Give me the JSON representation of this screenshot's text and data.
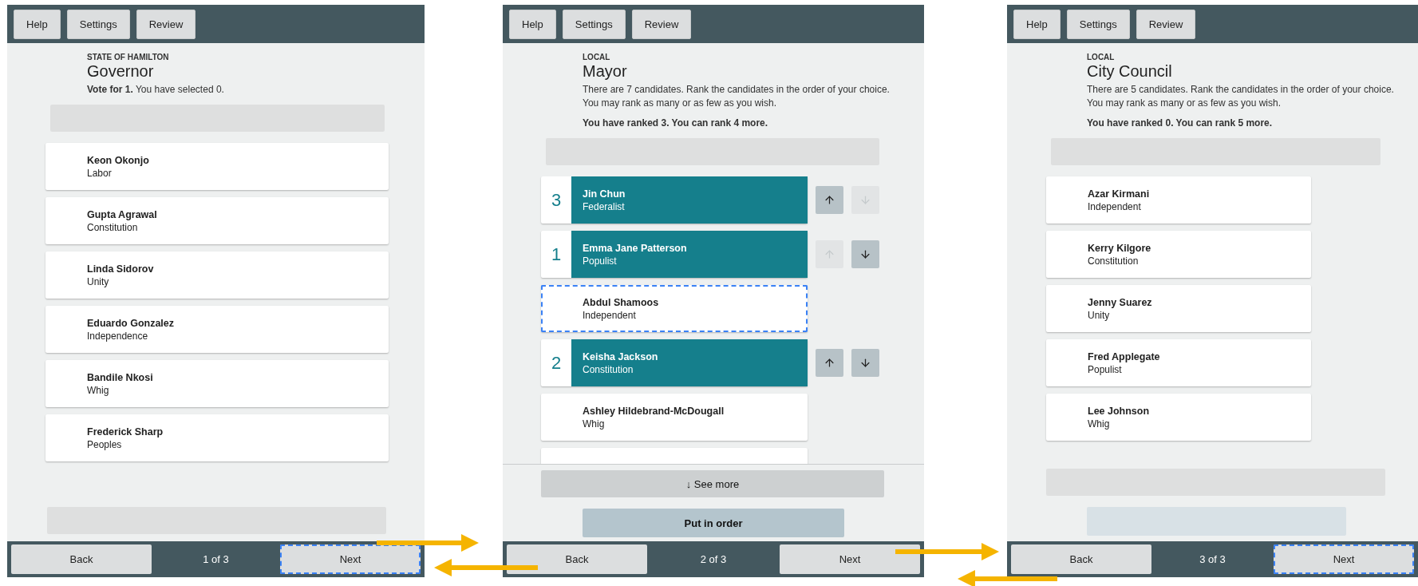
{
  "screens": [
    {
      "toolbar": [
        "Help",
        "Settings",
        "Review"
      ],
      "district": "STATE OF HAMILTON",
      "title": "Governor",
      "instructions": [
        "**Vote for 1.** You have selected 0."
      ],
      "top_button": {
        "disabled": true
      },
      "candidates": [
        {
          "name": "Keon Okonjo",
          "party": "Labor",
          "selected": false,
          "focused": false
        },
        {
          "name": "Gupta Agrawal",
          "party": "Constitution",
          "selected": false,
          "focused": false
        },
        {
          "name": "Linda Sidorov",
          "party": "Unity",
          "selected": false,
          "focused": false
        },
        {
          "name": "Eduardo Gonzalez",
          "party": "Independence",
          "selected": false,
          "focused": false
        },
        {
          "name": "Bandile Nkosi",
          "party": "Whig",
          "selected": false,
          "focused": false
        },
        {
          "name": "Frederick Sharp",
          "party": "Peoples",
          "selected": false,
          "focused": false
        }
      ],
      "bottom_buttons": [
        {
          "kind": "wide",
          "disabled": true
        }
      ],
      "nav": {
        "back": "Back",
        "page": "1 of 3",
        "next": "Next",
        "next_focused": true
      }
    },
    {
      "toolbar": [
        "Help",
        "Settings",
        "Review"
      ],
      "district": "LOCAL",
      "title": "Mayor",
      "instructions": [
        "There are 7 candidates. Rank the candidates in the order of your choice. You may rank as many or as few as you wish.",
        "**You have ranked 3. You can rank 4 more.**"
      ],
      "top_button": {
        "disabled": true
      },
      "more_below": true,
      "candidates": [
        {
          "name": "Jin Chun",
          "party": "Federalist",
          "rank": "3",
          "can_move_up": true,
          "can_move_down": false,
          "focused": false
        },
        {
          "name": "Emma Jane Patterson",
          "party": "Populist",
          "rank": "1",
          "can_move_up": false,
          "can_move_down": true,
          "focused": false
        },
        {
          "name": "Abdul Shamoos",
          "party": "Independent",
          "focused": true
        },
        {
          "name": "Keisha Jackson",
          "party": "Constitution",
          "rank": "2",
          "can_move_up": true,
          "can_move_down": true,
          "focused": false
        },
        {
          "name": "Ashley Hildebrand-McDougall",
          "party": "Whig",
          "focused": false
        }
      ],
      "bottom_buttons": [
        {
          "kind": "wide",
          "label": "↓ See more",
          "disabled": false
        },
        {
          "kind": "order",
          "label": "Put in order",
          "disabled": false
        }
      ],
      "nav": {
        "back": "Back",
        "page": "2 of 3",
        "next": "Next",
        "next_focused": false
      }
    },
    {
      "toolbar": [
        "Help",
        "Settings",
        "Review"
      ],
      "district": "LOCAL",
      "title": "City Council",
      "instructions": [
        "There are 5 candidates. Rank the candidates in the order of your choice. You may rank as many or as few as you wish.",
        "**You have ranked 0. You can rank 5 more.**"
      ],
      "top_button": {
        "disabled": true
      },
      "candidates": [
        {
          "name": "Azar Kirmani",
          "party": "Independent",
          "focused": false
        },
        {
          "name": "Kerry Kilgore",
          "party": "Constitution",
          "focused": false
        },
        {
          "name": "Jenny Suarez",
          "party": "Unity",
          "focused": false
        },
        {
          "name": "Fred Applegate",
          "party": "Populist",
          "focused": false
        },
        {
          "name": "Lee Johnson",
          "party": "Whig",
          "focused": false
        }
      ],
      "bottom_buttons": [
        {
          "kind": "wide",
          "disabled": true
        },
        {
          "kind": "order",
          "disabled": true
        }
      ],
      "nav": {
        "back": "Back",
        "page": "3 of 3",
        "next": "Next",
        "next_focused": true
      }
    }
  ]
}
